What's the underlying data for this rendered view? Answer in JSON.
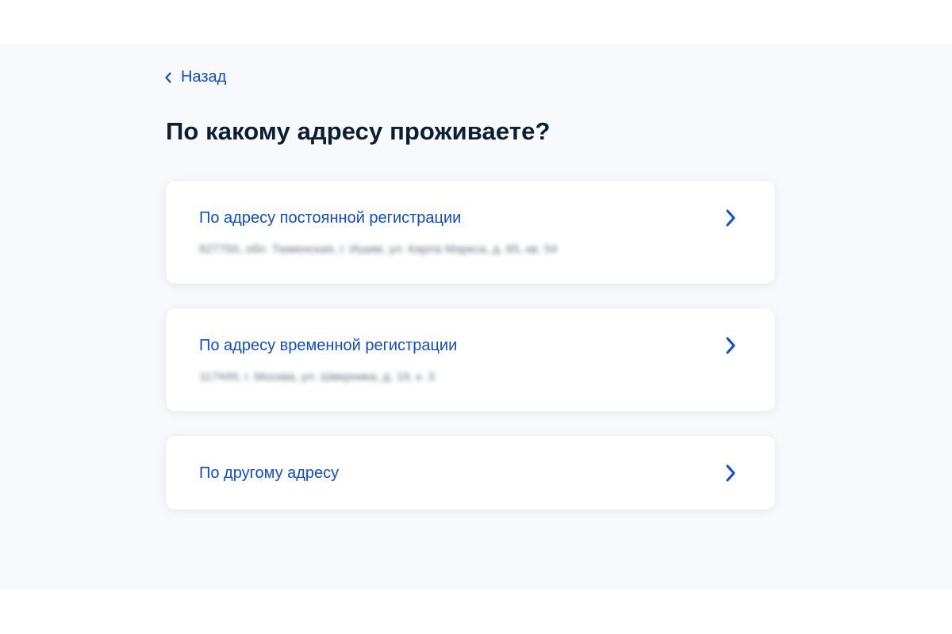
{
  "back": {
    "label": "Назад"
  },
  "title": "По какому адресу проживаете?",
  "options": [
    {
      "title": "По адресу постоянной регистрации",
      "address": "627750, обл. Тюменская, г. Ишим, ул. Карла Маркса, д. 65, кв. 54"
    },
    {
      "title": "По адресу временной регистрации",
      "address": "117449, г. Москва, ул. Шверника, д. 19, к. 3"
    },
    {
      "title": "По другому адресу"
    }
  ],
  "icons": {
    "back": "chevron-left-icon",
    "option": "chevron-right-icon"
  },
  "colors": {
    "accent": "#0d4cd3",
    "title": "#0b1f33",
    "background": "#f8f9fc",
    "card": "#ffffff"
  }
}
